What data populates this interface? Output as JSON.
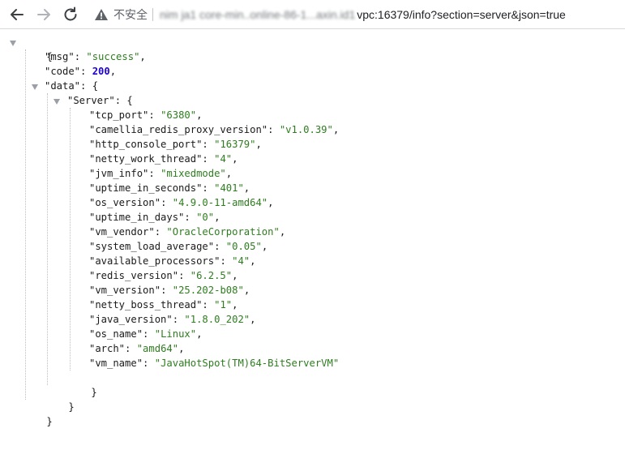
{
  "browser": {
    "insecure_label": "不安全",
    "url_host_obscured": "nim ja1 core-min..online-86-1...axin.id1",
    "url_host_visible": "vpc:16379/info?section=server&json=true",
    "icons": {
      "back": "arrow-left-icon",
      "forward": "arrow-right-icon",
      "reload": "reload-icon",
      "warning": "warning-triangle-icon"
    },
    "colors": {
      "string": "#2e7d1f",
      "number": "#1c00cf"
    }
  },
  "json": {
    "open_brace": "{",
    "msg_key": "\"msg\"",
    "msg_value": "\"success\"",
    "code_key": "\"code\"",
    "code_value": "200",
    "data_key": "\"data\"",
    "server_key": "\"Server\"",
    "server_fields": [
      {
        "key": "\"tcp_port\"",
        "value": "\"6380\""
      },
      {
        "key": "\"camellia_redis_proxy_version\"",
        "value": "\"v1.0.39\""
      },
      {
        "key": "\"http_console_port\"",
        "value": "\"16379\""
      },
      {
        "key": "\"netty_work_thread\"",
        "value": "\"4\""
      },
      {
        "key": "\"jvm_info\"",
        "value": "\"mixedmode\""
      },
      {
        "key": "\"uptime_in_seconds\"",
        "value": "\"401\""
      },
      {
        "key": "\"os_version\"",
        "value": "\"4.9.0-11-amd64\""
      },
      {
        "key": "\"uptime_in_days\"",
        "value": "\"0\""
      },
      {
        "key": "\"vm_vendor\"",
        "value": "\"OracleCorporation\""
      },
      {
        "key": "\"system_load_average\"",
        "value": "\"0.05\""
      },
      {
        "key": "\"available_processors\"",
        "value": "\"4\""
      },
      {
        "key": "\"redis_version\"",
        "value": "\"6.2.5\""
      },
      {
        "key": "\"vm_version\"",
        "value": "\"25.202-b08\""
      },
      {
        "key": "\"netty_boss_thread\"",
        "value": "\"1\""
      },
      {
        "key": "\"java_version\"",
        "value": "\"1.8.0_202\""
      },
      {
        "key": "\"os_name\"",
        "value": "\"Linux\""
      },
      {
        "key": "\"arch\"",
        "value": "\"amd64\""
      },
      {
        "key": "\"vm_name\"",
        "value": "\"JavaHotSpot(TM)64-BitServerVM\""
      }
    ],
    "close_server": "}",
    "close_data": "}",
    "close_root": "}"
  }
}
